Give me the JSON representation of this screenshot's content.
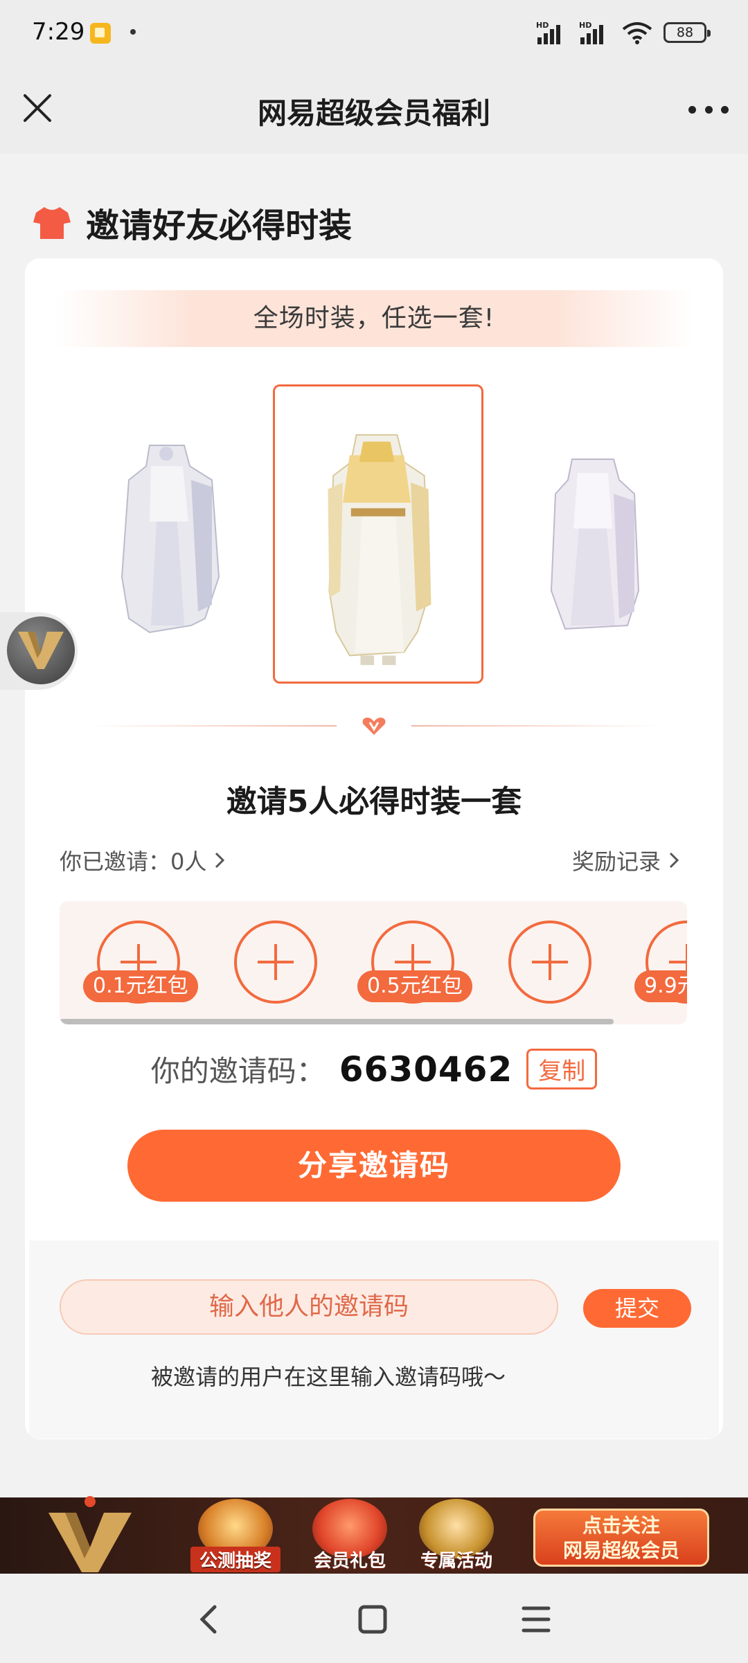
{
  "status_bar": {
    "time": "7:29",
    "battery": "88"
  },
  "nav": {
    "title": "网易超级会员福利"
  },
  "section": {
    "title": "邀请好友必得时装"
  },
  "card": {
    "banner_text": "全场时装，任选一套!",
    "invite_title": "邀请5人必得时装一套",
    "invited_text": "你已邀请：0人",
    "reward_record": "奖励记录",
    "slots": [
      {
        "tag": "0.1元红包"
      },
      {
        "tag": ""
      },
      {
        "tag": "0.5元红包"
      },
      {
        "tag": ""
      },
      {
        "tag": "9.9元"
      }
    ],
    "code_label": "你的邀请码：",
    "code_value": "6630462",
    "copy_label": "复制",
    "share_button": "分享邀请码",
    "input_placeholder": "输入他人的邀请码",
    "submit_label": "提交",
    "input_hint": "被邀请的用户在这里输入邀请码哦～"
  },
  "promo_bar": {
    "items": [
      {
        "label": "公测抽奖"
      },
      {
        "label": "会员礼包"
      },
      {
        "label": "专属活动"
      }
    ],
    "follow_line1": "点击关注",
    "follow_line2": "网易超级会员"
  },
  "colors": {
    "accent": "#ff6a34",
    "accent_border": "#f26a3e"
  }
}
